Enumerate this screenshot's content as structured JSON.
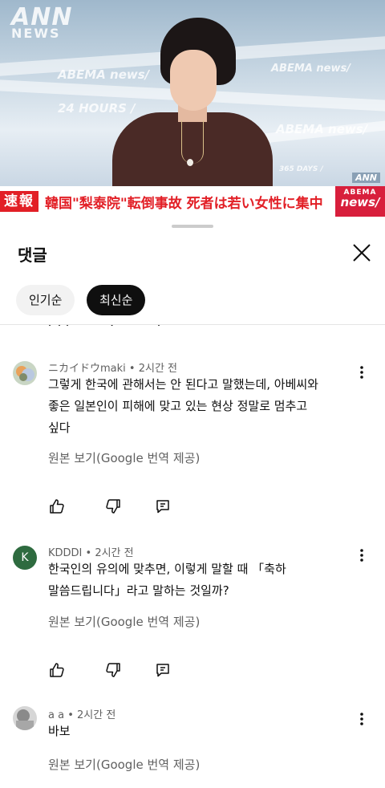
{
  "video": {
    "watermark_ann": "ANN",
    "watermark_news": "NEWS",
    "bg_texts": [
      "ABEMA news/",
      "24 HOURS /",
      "ABEMA news/",
      "ABEMA news/",
      "365 DAYS /"
    ],
    "corner_logo": "ANN",
    "ticker_label": "速報",
    "ticker_text": "韓国\"梨泰院\"転倒事故 死者は若い女性に集中",
    "brand_top": "ABEMA",
    "brand_bottom": "news/",
    "ticker_color": "#e21f26"
  },
  "sheet": {
    "title": "댓글",
    "chips": {
      "popular": "인기순",
      "newest": "최신순"
    }
  },
  "comments": [
    {
      "author": "ニカイドウmaki",
      "time": "2시간 전",
      "lines": [
        "그렇게 한국에 관해서는 안 된다고 말했는데, 아베씨와",
        "좋은 일본인이 피해에 맞고 있는 현상 정말로 멈추고",
        "싶다"
      ],
      "translate": "원본 보기(Google 번역 제공)",
      "avatar_icon": "photo-avatar"
    },
    {
      "author": "KDDDI",
      "time": "2시간 전",
      "avatar_letter": "K",
      "avatar_color": "#2e6b3f",
      "lines": [
        "한국인의 유의에 맞추면, 이렇게 말할 때 「축하",
        "말씀드립니다」라고 말하는 것일까?"
      ],
      "translate": "원본 보기(Google 번역 제공)"
    },
    {
      "author": "a a",
      "time": "2시간 전",
      "lines": [
        "바보"
      ],
      "translate": "원본 보기(Google 번역 제공)",
      "avatar_icon": "photo-avatar"
    }
  ]
}
